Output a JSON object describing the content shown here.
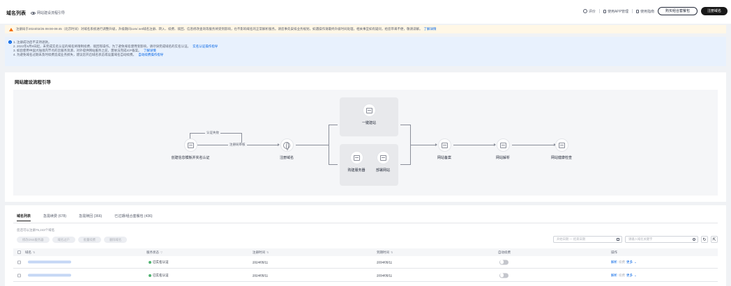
{
  "header": {
    "title": "域名列表",
    "subtitle": "网站建设流程引导",
    "links": [
      "评价",
      "使用APP管理",
      "使用指南"
    ],
    "buy_combo": "购买组合套餐包",
    "register": "注册域名"
  },
  "warning": {
    "text": "注册局于2024/02/25 09:00-09:45（北京时间）对域名系统进行调整升级，升级期间com/.net域名注册、转入、续费、赎回、信息修改查询等服务将受到影响，也不影响域名的正常解析服务。请您事先安排业务规划，如遇操作请最终升级时间处理，相关事宜如有疑问，给您带来不便，敬请谅解。",
    "link": "了解详情"
  },
  "info": {
    "line1": "1. 注册成功后不支持退款。",
    "line2": "2. 2022年6月9日起，未完成实名认证的域名将限制续费、赎回等操作。为了避免域名使用受影响，请尽快完成域名的实名认证。",
    "line2_link": "实名认证操作指导",
    "line3": "3. 如您使用中国大陆境内节点的云服务资源，对外提供网站服务之前，需依法完成ICP备案。",
    "line3_link": "了解详情",
    "line4": "4. 为避免域名过期未及时续费造成业务损失，建议您开启域名状态或设置域名自动续费。",
    "line4_link": "自动续费操作指导"
  },
  "flow": {
    "title": "网站建设流程引导",
    "fail_label": "认证失败",
    "audit_label": "注册局审核",
    "node_template": "创建信息模板并实名认证",
    "node_register": "注册域名",
    "node_oneclick": "一键建站",
    "node_buy_server": "购建服务器",
    "node_deploy": "部署网站",
    "node_icp": "网站备案",
    "node_dns": "网站解析",
    "node_health": "网站健康检查"
  },
  "table": {
    "tabs": [
      "域名列表",
      "急需续费 (678)",
      "急需赎回 (366)",
      "已过期/组合套餐包 (436)"
    ],
    "quota": "您还可以注册75,243个域名",
    "actions": [
      "修改DNS服务器",
      "域名过户",
      "批量续费",
      "删除域名"
    ],
    "date_placeholder": "开始日期 — 结束日期",
    "search_placeholder": "请输入域名关键字",
    "columns": {
      "domain": "域名",
      "status": "服务状态",
      "register": "注册时间",
      "expire": "到期时间",
      "auto_renew": "自动续费",
      "ops": "操作"
    },
    "rows": [
      {
        "status": "已实名认证",
        "register": "2024/05/11",
        "expire": "2034/05/11",
        "op1": "解析",
        "op2": "续费",
        "op3": "更多"
      },
      {
        "status": "已实名认证",
        "register": "2024/05/11",
        "expire": "2034/05/11",
        "op1": "解析",
        "op2": "续费",
        "op3": "更多"
      }
    ]
  },
  "colors": {
    "accent": "#0063e5",
    "warning": "#f66f00",
    "success": "#50b371",
    "dark": "#191919"
  }
}
